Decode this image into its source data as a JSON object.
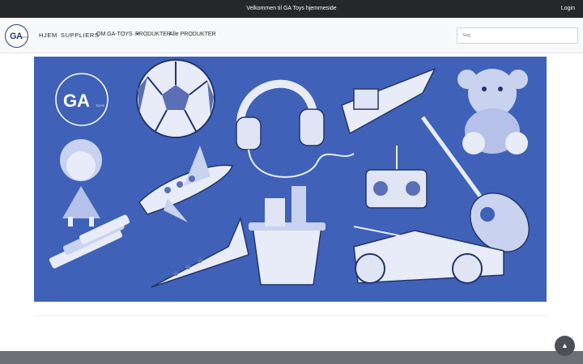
{
  "topbar": {
    "welcome": "Velkommen til GA Toys hjemmeside",
    "login": "Login"
  },
  "logo": {
    "ga": "GA",
    "toys": "TOYS"
  },
  "nav": {
    "home": "HJEM",
    "suppliers": "SUPPLIERS",
    "about": "OM GA-TOYS",
    "products": "PRODUKTER",
    "all_products": "Alle PRODUKTER"
  },
  "search": {
    "placeholder": "Søg"
  },
  "banner": {
    "logo_ga": "GA",
    "logo_toys": "TOYS"
  },
  "colors": {
    "banner_bg": "#3f62b8",
    "topbar_bg": "#25272b",
    "footer_bg": "#6e7075"
  },
  "icons": {
    "scroll_top": "chevron-up-icon",
    "dropdown": "caret-down-icon"
  }
}
